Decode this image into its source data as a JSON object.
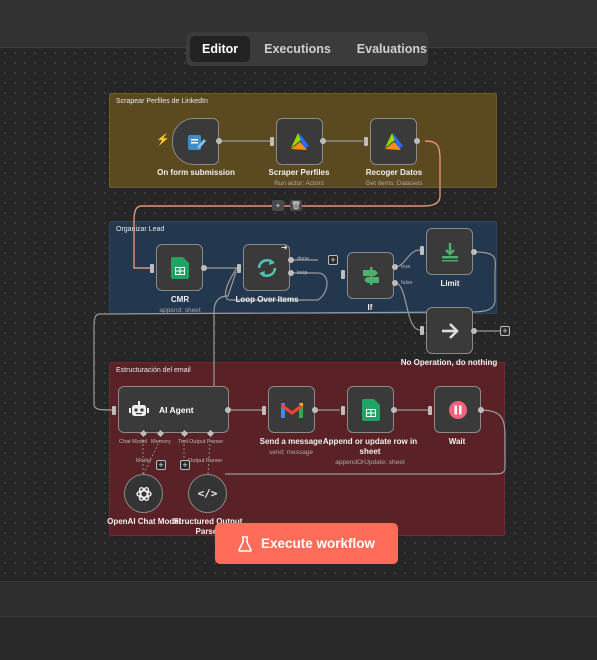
{
  "tabs": {
    "editor": "Editor",
    "executions": "Executions",
    "evaluations": "Evaluations",
    "active": "Editor"
  },
  "groups": {
    "scraper": "Scrapear Perfiles de LinkedIn",
    "organizar": "Organizar Lead",
    "estructuracion": "Estructuración del email"
  },
  "nodes": {
    "form": {
      "label": "On form submission"
    },
    "scraper": {
      "label": "Scraper Perfiles",
      "sub": "Run actor: Actors"
    },
    "recoger": {
      "label": "Recoger Datos",
      "sub": "Get items: Datasets"
    },
    "cmr": {
      "label": "CMR",
      "sub": "append: sheet"
    },
    "loop": {
      "label": "Loop Over Items",
      "out_done": "done",
      "out_loop": "loop"
    },
    "if": {
      "label": "If",
      "out_true": "true",
      "out_false": "false"
    },
    "limit": {
      "label": "Limit"
    },
    "noop": {
      "label": "No Operation, do nothing"
    },
    "agent": {
      "label": "AI Agent",
      "in_chat_model": "Chat Model",
      "in_memory": "Memory",
      "in_tool": "Tool",
      "in_parser": "Output Parser"
    },
    "gmail": {
      "label": "Send a message",
      "sub": "send: message"
    },
    "append": {
      "label": "Append or update row in sheet",
      "sub": "appendOrUpdate: sheet"
    },
    "wait": {
      "label": "Wait"
    },
    "openai": {
      "label": "OpenAI Chat Model",
      "port": "Model"
    },
    "parser": {
      "label": "Structured Output Parser",
      "port": "Output Parser"
    }
  },
  "execute_button": {
    "label": "Execute workflow"
  },
  "colors": {
    "accent": "#ff6d5a",
    "group_scraper": "#5b4a1f",
    "group_organizar": "#23374f",
    "group_email": "#5a2226",
    "sheets_green": "#21a366"
  }
}
